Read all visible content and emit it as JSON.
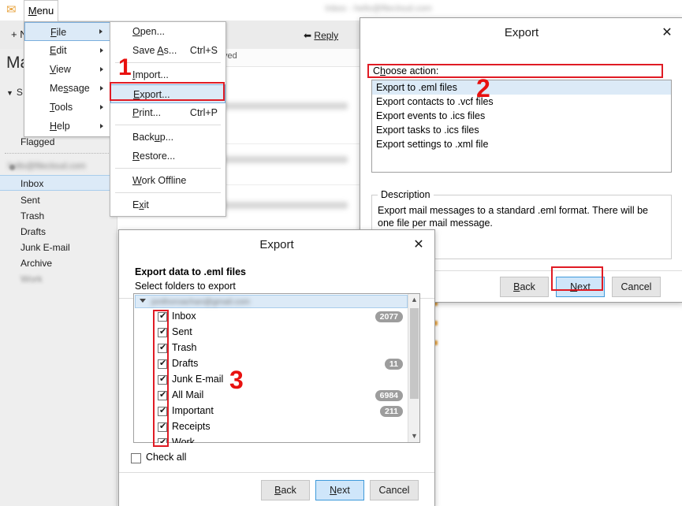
{
  "app": {
    "logo_icon": "envelope-icon",
    "title_blurred": "Inbox - hello@filecloud.com",
    "new_button": "+ N",
    "reply_button": "Reply",
    "mail_heading": "Ma",
    "smart_folders_label": "S",
    "smart_items": [
      "Flagged"
    ],
    "account_blurred": "hello@filecloud.com",
    "folders": [
      "Inbox",
      "Sent",
      "Trash",
      "Drafts",
      "Junk E-mail",
      "Archive",
      "Work"
    ],
    "received_column": "ved"
  },
  "menu": {
    "tab_label": "Menu",
    "tab_accel": "M",
    "level1": [
      {
        "label": "File",
        "accel": "F",
        "submenu": true,
        "highlighted": true
      },
      {
        "label": "Edit",
        "accel": "E",
        "submenu": true,
        "highlighted": false
      },
      {
        "label": "View",
        "accel": "V",
        "submenu": true,
        "highlighted": false
      },
      {
        "label": "Message",
        "accel": "s",
        "submenu": true,
        "highlighted": false
      },
      {
        "label": "Tools",
        "accel": "T",
        "submenu": true,
        "highlighted": false
      },
      {
        "label": "Help",
        "accel": "H",
        "submenu": true,
        "highlighted": false
      }
    ],
    "level2": [
      {
        "label": "Open...",
        "accel": "O",
        "shortcut": "",
        "sep_after": false,
        "highlighted": false
      },
      {
        "label": "Save As...",
        "accel": "A",
        "shortcut": "Ctrl+S",
        "sep_after": true,
        "highlighted": false
      },
      {
        "label": "Import...",
        "accel": "I",
        "shortcut": "",
        "sep_after": false,
        "highlighted": false
      },
      {
        "label": "Export...",
        "accel": "E",
        "shortcut": "",
        "sep_after": false,
        "highlighted": true
      },
      {
        "label": "Print...",
        "accel": "P",
        "shortcut": "Ctrl+P",
        "sep_after": true,
        "highlighted": false
      },
      {
        "label": "Backup...",
        "accel": "p",
        "shortcut": "",
        "sep_after": false,
        "highlighted": false
      },
      {
        "label": "Restore...",
        "accel": "R",
        "shortcut": "",
        "sep_after": true,
        "highlighted": false
      },
      {
        "label": "Work Offline",
        "accel": "W",
        "shortcut": "",
        "sep_after": true,
        "highlighted": false
      },
      {
        "label": "Exit",
        "accel": "x",
        "shortcut": "",
        "sep_after": false,
        "highlighted": false
      }
    ]
  },
  "annotations": {
    "step1": "1",
    "step2": "2",
    "step3": "3",
    "color": "#e8110f"
  },
  "dialog_action": {
    "title": "Export",
    "close_icon": "close-icon",
    "choose_label": "Choose action:",
    "choose_accel": "h",
    "actions": [
      {
        "label": "Export to .eml files",
        "selected": true
      },
      {
        "label": "Export contacts to .vcf files",
        "selected": false
      },
      {
        "label": "Export events to .ics files",
        "selected": false
      },
      {
        "label": "Export tasks to .ics files",
        "selected": false
      },
      {
        "label": "Export settings to .xml file",
        "selected": false
      }
    ],
    "description_legend": "Description",
    "description_text": "Export mail messages to a standard .eml format. There will be one file per mail message.",
    "buttons": {
      "back": "Back",
      "back_accel": "B",
      "next": "Next",
      "next_accel": "N",
      "cancel": "Cancel"
    }
  },
  "dialog_folders": {
    "title": "Export",
    "close_icon": "close-icon",
    "subtitle": "Export data to .eml files",
    "subtext": "Select folders to export",
    "account_blurred": "jonthoroachan@gmail.com",
    "folders": [
      {
        "label": "Inbox",
        "checked": true,
        "count": "2077"
      },
      {
        "label": "Sent",
        "checked": true,
        "count": ""
      },
      {
        "label": "Trash",
        "checked": true,
        "count": ""
      },
      {
        "label": "Drafts",
        "checked": true,
        "count": "11"
      },
      {
        "label": "Junk E-mail",
        "checked": true,
        "count": ""
      },
      {
        "label": "All Mail",
        "checked": true,
        "count": "6984"
      },
      {
        "label": "Important",
        "checked": true,
        "count": "211"
      },
      {
        "label": "Receipts",
        "checked": true,
        "count": ""
      },
      {
        "label": "Work",
        "checked": true,
        "count": ""
      }
    ],
    "check_all_label": "Check all",
    "check_all_checked": false,
    "scroll_up_icon": "chevron-up-icon",
    "scroll_down_icon": "chevron-down-icon",
    "buttons": {
      "back": "Back",
      "back_accel": "B",
      "next": "Next",
      "next_accel": "N",
      "cancel": "Cancel"
    }
  }
}
